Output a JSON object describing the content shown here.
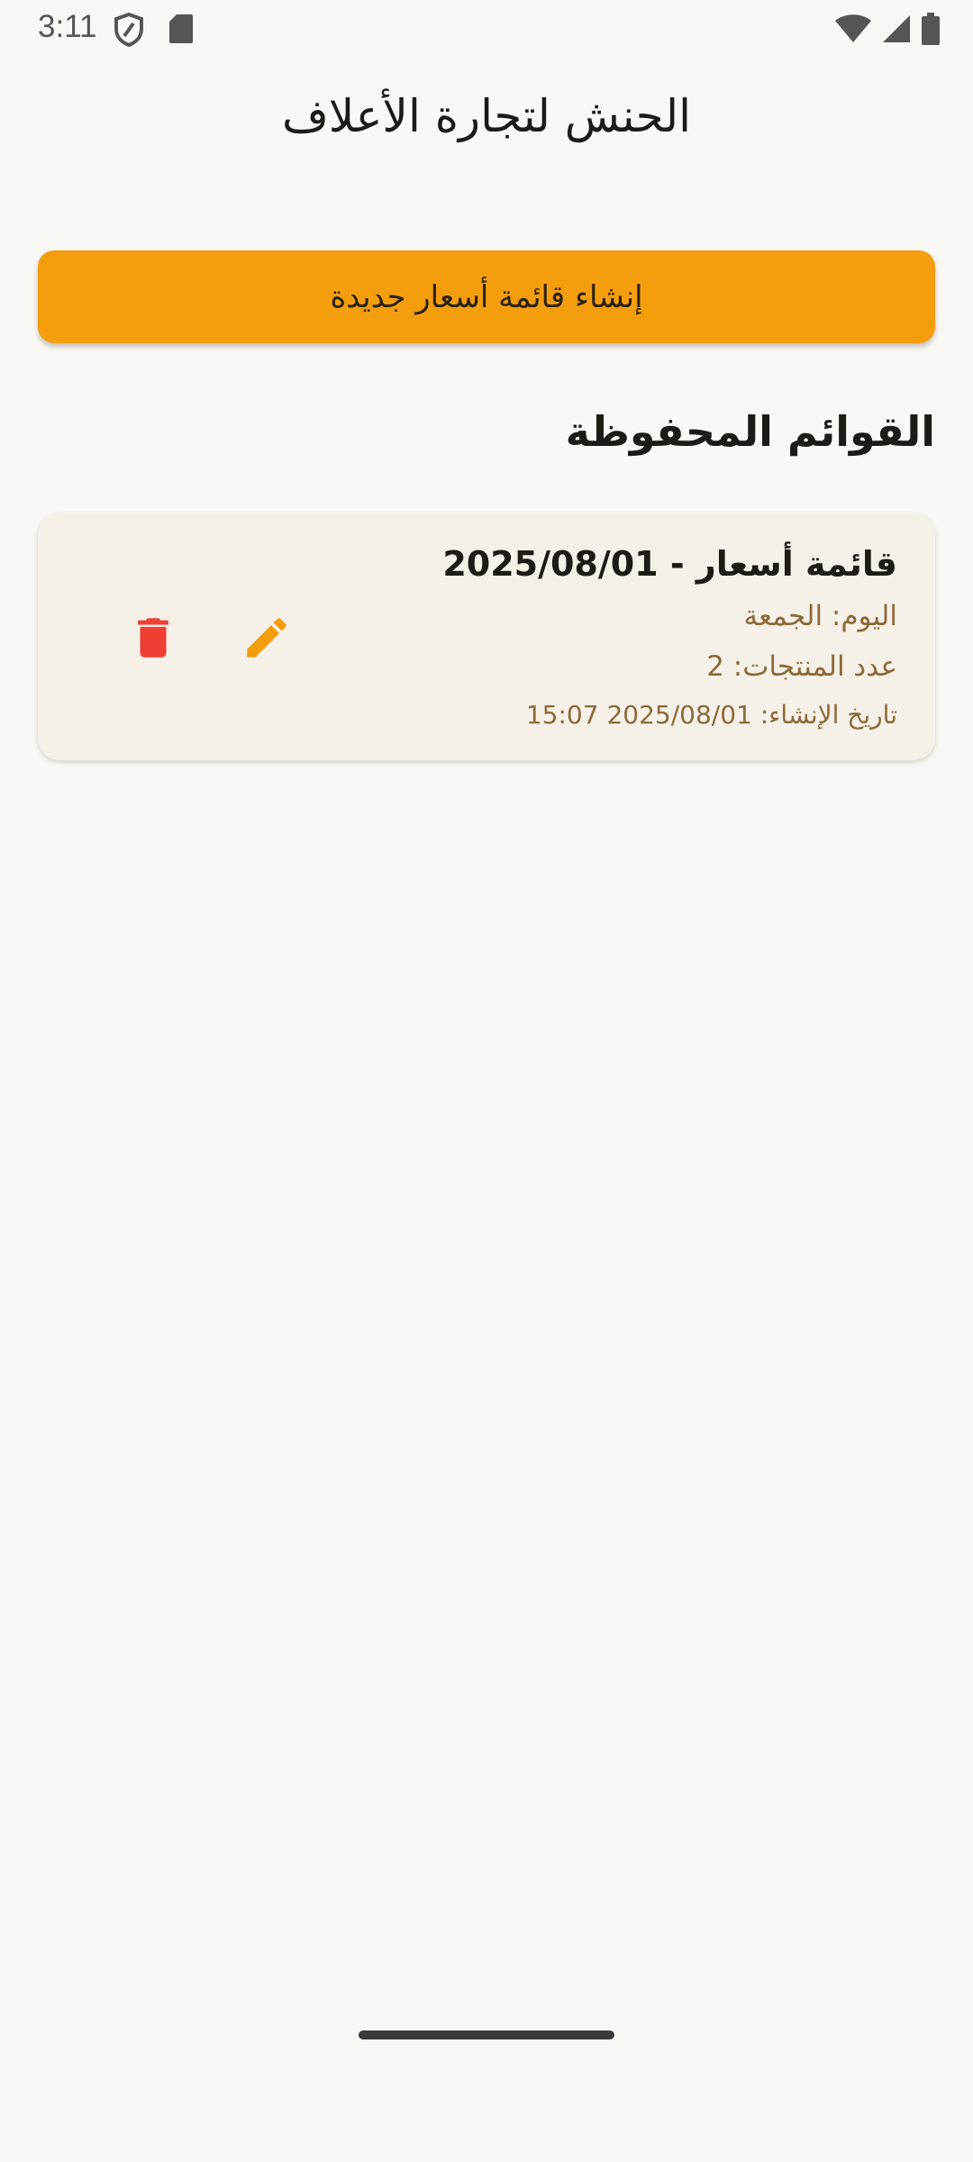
{
  "status_bar": {
    "time": "3:11",
    "icons": [
      "shield-icon",
      "sd-card-icon",
      "wifi-icon",
      "signal-icon",
      "battery-icon"
    ]
  },
  "app": {
    "title": "الحنش لتجارة الأعلاف"
  },
  "create_button": {
    "label": "إنشاء قائمة أسعار جديدة"
  },
  "saved_lists": {
    "heading": "القوائم المحفوظة",
    "items": [
      {
        "title": "قائمة أسعار - 2025/08/01",
        "day": "اليوم: الجمعة",
        "products_count": "عدد المنتجات: 2",
        "created_at": "تاريخ الإنشاء: 2025/08/01 15:07",
        "edit_icon": "pencil-icon",
        "delete_icon": "trash-icon"
      }
    ]
  },
  "colors": {
    "background": "#faf8f4",
    "accent": "#f49e0e",
    "delete": "#ef3f35",
    "card": "#f5f0e8",
    "secondary_text": "#8c6a3a"
  }
}
